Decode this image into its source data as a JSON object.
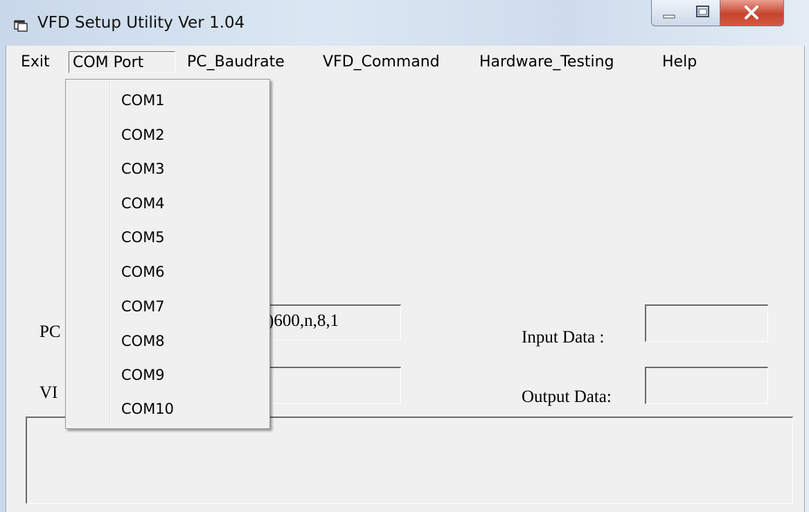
{
  "window": {
    "title": "VFD Setup Utility Ver 1.04",
    "close_glyph": "X",
    "max_glyph": "□",
    "min_glyph": "_"
  },
  "menu": {
    "items": [
      "Exit",
      "COM Port",
      "PC_Baudrate",
      "VFD_Command",
      "Hardware_Testing",
      "Help"
    ],
    "active": "COM Port"
  },
  "com_menu": {
    "items": [
      "COM1",
      "COM2",
      "COM3",
      "COM4",
      "COM5",
      "COM6",
      "COM7",
      "COM8",
      "COM9",
      "COM10"
    ]
  },
  "form": {
    "pc_label_visible": "PC",
    "pc_value_visible": ")600,n,8,1",
    "vfd_label_visible": "VI",
    "vfd_value": "",
    "input_label": "Input  Data :",
    "input_value": "",
    "output_label": "Output Data:",
    "output_value": "",
    "log": ""
  },
  "icons": {
    "app": "app-window-icon",
    "minimize": "minimize-icon",
    "maximize": "maximize-icon",
    "close": "close-icon"
  }
}
